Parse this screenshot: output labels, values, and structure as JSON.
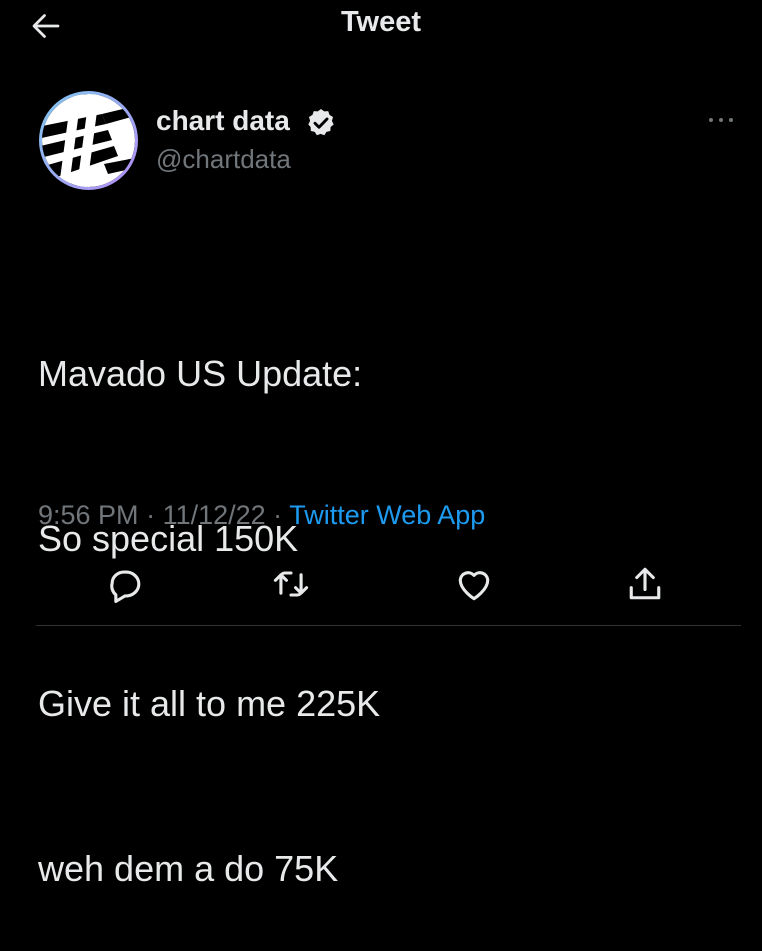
{
  "header": {
    "title": "Tweet",
    "back_icon": "arrow-left-icon"
  },
  "author": {
    "name": "chart data",
    "handle": "@chartdata",
    "verified": true,
    "avatar_icon": "chart-data-logo"
  },
  "tweet": {
    "lines": [
      "Mavado US Update:",
      "So special 150K",
      "Give it all to me 225K",
      "weh dem a do 75K"
    ]
  },
  "meta": {
    "time": "9:56 PM",
    "sep1": " · ",
    "date": "11/12/22",
    "sep2": " · ",
    "source": "Twitter Web App"
  },
  "actions": {
    "reply": "reply-icon",
    "retweet": "retweet-icon",
    "like": "heart-icon",
    "share": "share-icon"
  },
  "colors": {
    "background": "#000000",
    "text": "#e7e9ea",
    "muted": "#71767b",
    "accent": "#1d9bf0"
  }
}
